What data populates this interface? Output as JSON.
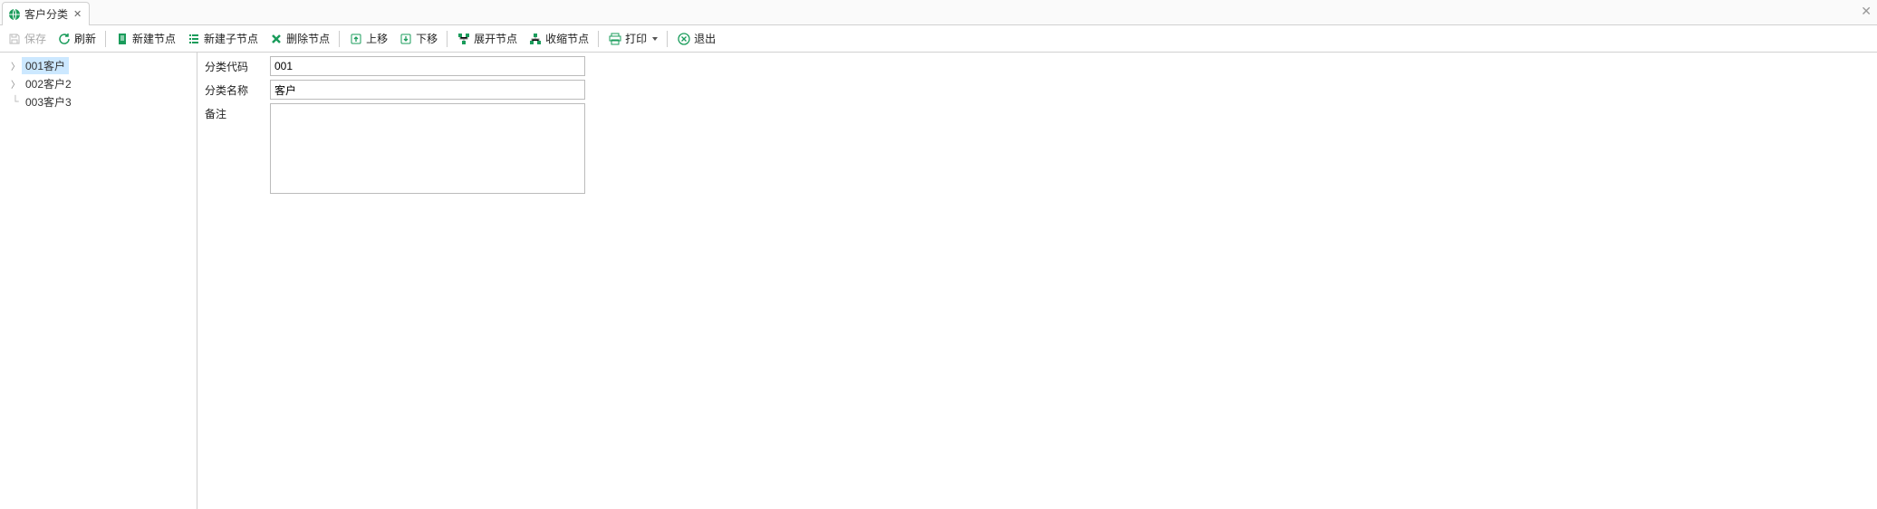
{
  "tab": {
    "title": "客户分类"
  },
  "toolbar": {
    "save": "保存",
    "refresh": "刷新",
    "new_node": "新建节点",
    "new_child": "新建子节点",
    "delete_node": "删除节点",
    "move_up": "上移",
    "move_down": "下移",
    "expand": "展开节点",
    "collapse": "收缩节点",
    "print": "打印",
    "exit": "退出"
  },
  "tree": {
    "items": [
      {
        "label": "001客户",
        "expandable": true,
        "selected": true
      },
      {
        "label": "002客户2",
        "expandable": true,
        "selected": false
      },
      {
        "label": "003客户3",
        "expandable": false,
        "selected": false
      }
    ]
  },
  "form": {
    "code_label": "分类代码",
    "code_value": "001",
    "name_label": "分类名称",
    "name_value": "客户",
    "remark_label": "备注",
    "remark_value": ""
  },
  "colors": {
    "accent": "#1a9c5b",
    "selection": "#cce8ff"
  }
}
